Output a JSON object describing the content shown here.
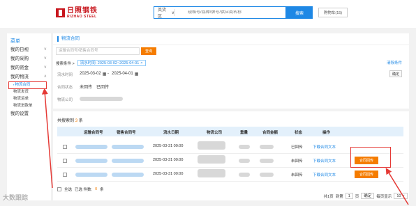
{
  "brand": {
    "cn": "日照钢铁",
    "en": "RIZHAO STEEL"
  },
  "search": {
    "scope": "英货区",
    "placeholder": "规格号/品种/牌号/供应商名称",
    "button": "搜索"
  },
  "cart": "购物车(15)",
  "sidebar": {
    "title": "菜单",
    "items": [
      {
        "label": "我的日视"
      },
      {
        "label": "我的采购"
      },
      {
        "label": "我的资金"
      },
      {
        "label": "我的物流"
      }
    ],
    "subitems": [
      {
        "label": "物流合同"
      },
      {
        "label": "物流发货"
      },
      {
        "label": "物流运单"
      },
      {
        "label": "物流进款单"
      }
    ],
    "last": "我的设置"
  },
  "main": {
    "title": "物流合同",
    "quick_placeholder": "运输合同号/销售合同号",
    "quick_button": "查询",
    "conditions_label": "搜索条件 >",
    "condition_tag": "流水时间: 2025-03-02~2025-04-01",
    "clear": "清除条件",
    "date_label": "流水时间",
    "date_from": "2025-03-02",
    "date_to": "2025-04-01",
    "confirm": "确定",
    "status_label": "合同状态",
    "status_opts": [
      "未回传",
      "已回传"
    ],
    "company_label": "物流公司"
  },
  "table": {
    "total_prefix": "共搜索到",
    "total": "3",
    "total_suffix": "条",
    "headers": [
      "运输合同号",
      "销售合同号",
      "流水日期",
      "物流公司",
      "重量",
      "合同金额",
      "状态",
      "操作"
    ],
    "rows": [
      {
        "date": "2025-03-31 00:00",
        "status": "已回传",
        "op": "下载合同文本",
        "button": ""
      },
      {
        "date": "2025-03-31 00:00",
        "status": "未回传",
        "op": "下载合同文本",
        "button": "合同回传"
      },
      {
        "date": "2025-03-31 00:00",
        "status": "未回传",
        "op": "下载合同文本",
        "button": "合同回传"
      }
    ],
    "footer": {
      "select_all": "全选",
      "selected": "已选 件数:",
      "count": "0",
      "unit": "条"
    },
    "pager": {
      "total_pages": "共1页",
      "goto": "到第",
      "page": "1",
      "page_unit": "页",
      "confirm": "确定",
      "per_page_label": "每页显示",
      "per_page": "10"
    }
  },
  "watermark": "大数跟踪",
  "colors": {
    "accent": "#1e88e5",
    "brand": "#c8161d",
    "action": "#f57c00",
    "highlight": "#e53935"
  }
}
